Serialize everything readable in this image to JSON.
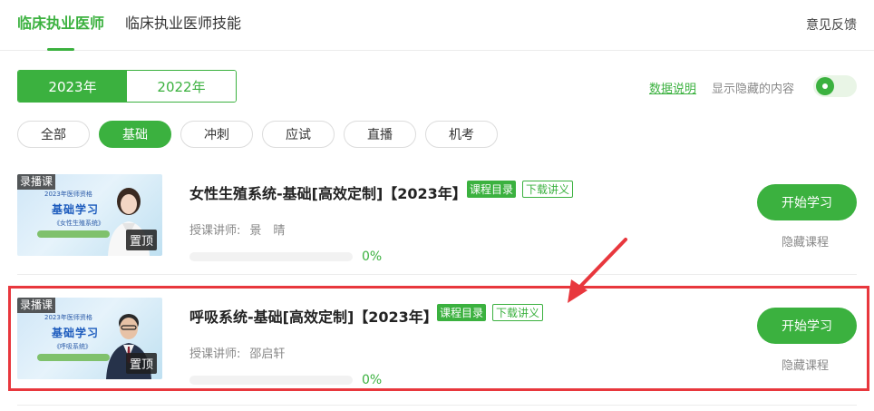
{
  "tabs": [
    {
      "label": "临床执业医师",
      "active": true
    },
    {
      "label": "临床执业医师技能",
      "active": false
    }
  ],
  "feedback_label": "意见反馈",
  "years": [
    {
      "label": "2023年",
      "active": true
    },
    {
      "label": "2022年",
      "active": false
    }
  ],
  "data_note_label": "数据说明",
  "show_hidden_label": "显示隐藏的内容",
  "show_hidden_toggle_on": true,
  "filters": [
    {
      "label": "全部",
      "active": false
    },
    {
      "label": "基础",
      "active": true
    },
    {
      "label": "冲刺",
      "active": false
    },
    {
      "label": "应试",
      "active": false
    },
    {
      "label": "直播",
      "active": false
    },
    {
      "label": "机考",
      "active": false
    }
  ],
  "courses": [
    {
      "badge": "录播课",
      "thumb_line1": "2023年医师资格",
      "thumb_title": "基础学习",
      "thumb_subtitle": "《女性生殖系统》",
      "pin_label": "置顶",
      "title": "女性生殖系统-基础[高效定制]【2023年】",
      "catalog_tag": "课程目录",
      "handout_tag": "下载讲义",
      "teacher_prefix": "授课讲师:",
      "teacher_name": "景　晴",
      "progress": 0,
      "progress_label": "0%",
      "start_label": "开始学习",
      "hide_label": "隐藏课程"
    },
    {
      "badge": "录播课",
      "thumb_line1": "2023年医师资格",
      "thumb_title": "基础学习",
      "thumb_subtitle": "《呼吸系统》",
      "pin_label": "置顶",
      "title": "呼吸系统-基础[高效定制]【2023年】",
      "catalog_tag": "课程目录",
      "handout_tag": "下载讲义",
      "teacher_prefix": "授课讲师:",
      "teacher_name": "邵启轩",
      "progress": 0,
      "progress_label": "0%",
      "start_label": "开始学习",
      "hide_label": "隐藏课程"
    }
  ],
  "colors": {
    "accent": "#3bb13f",
    "highlight": "#e8373d"
  }
}
